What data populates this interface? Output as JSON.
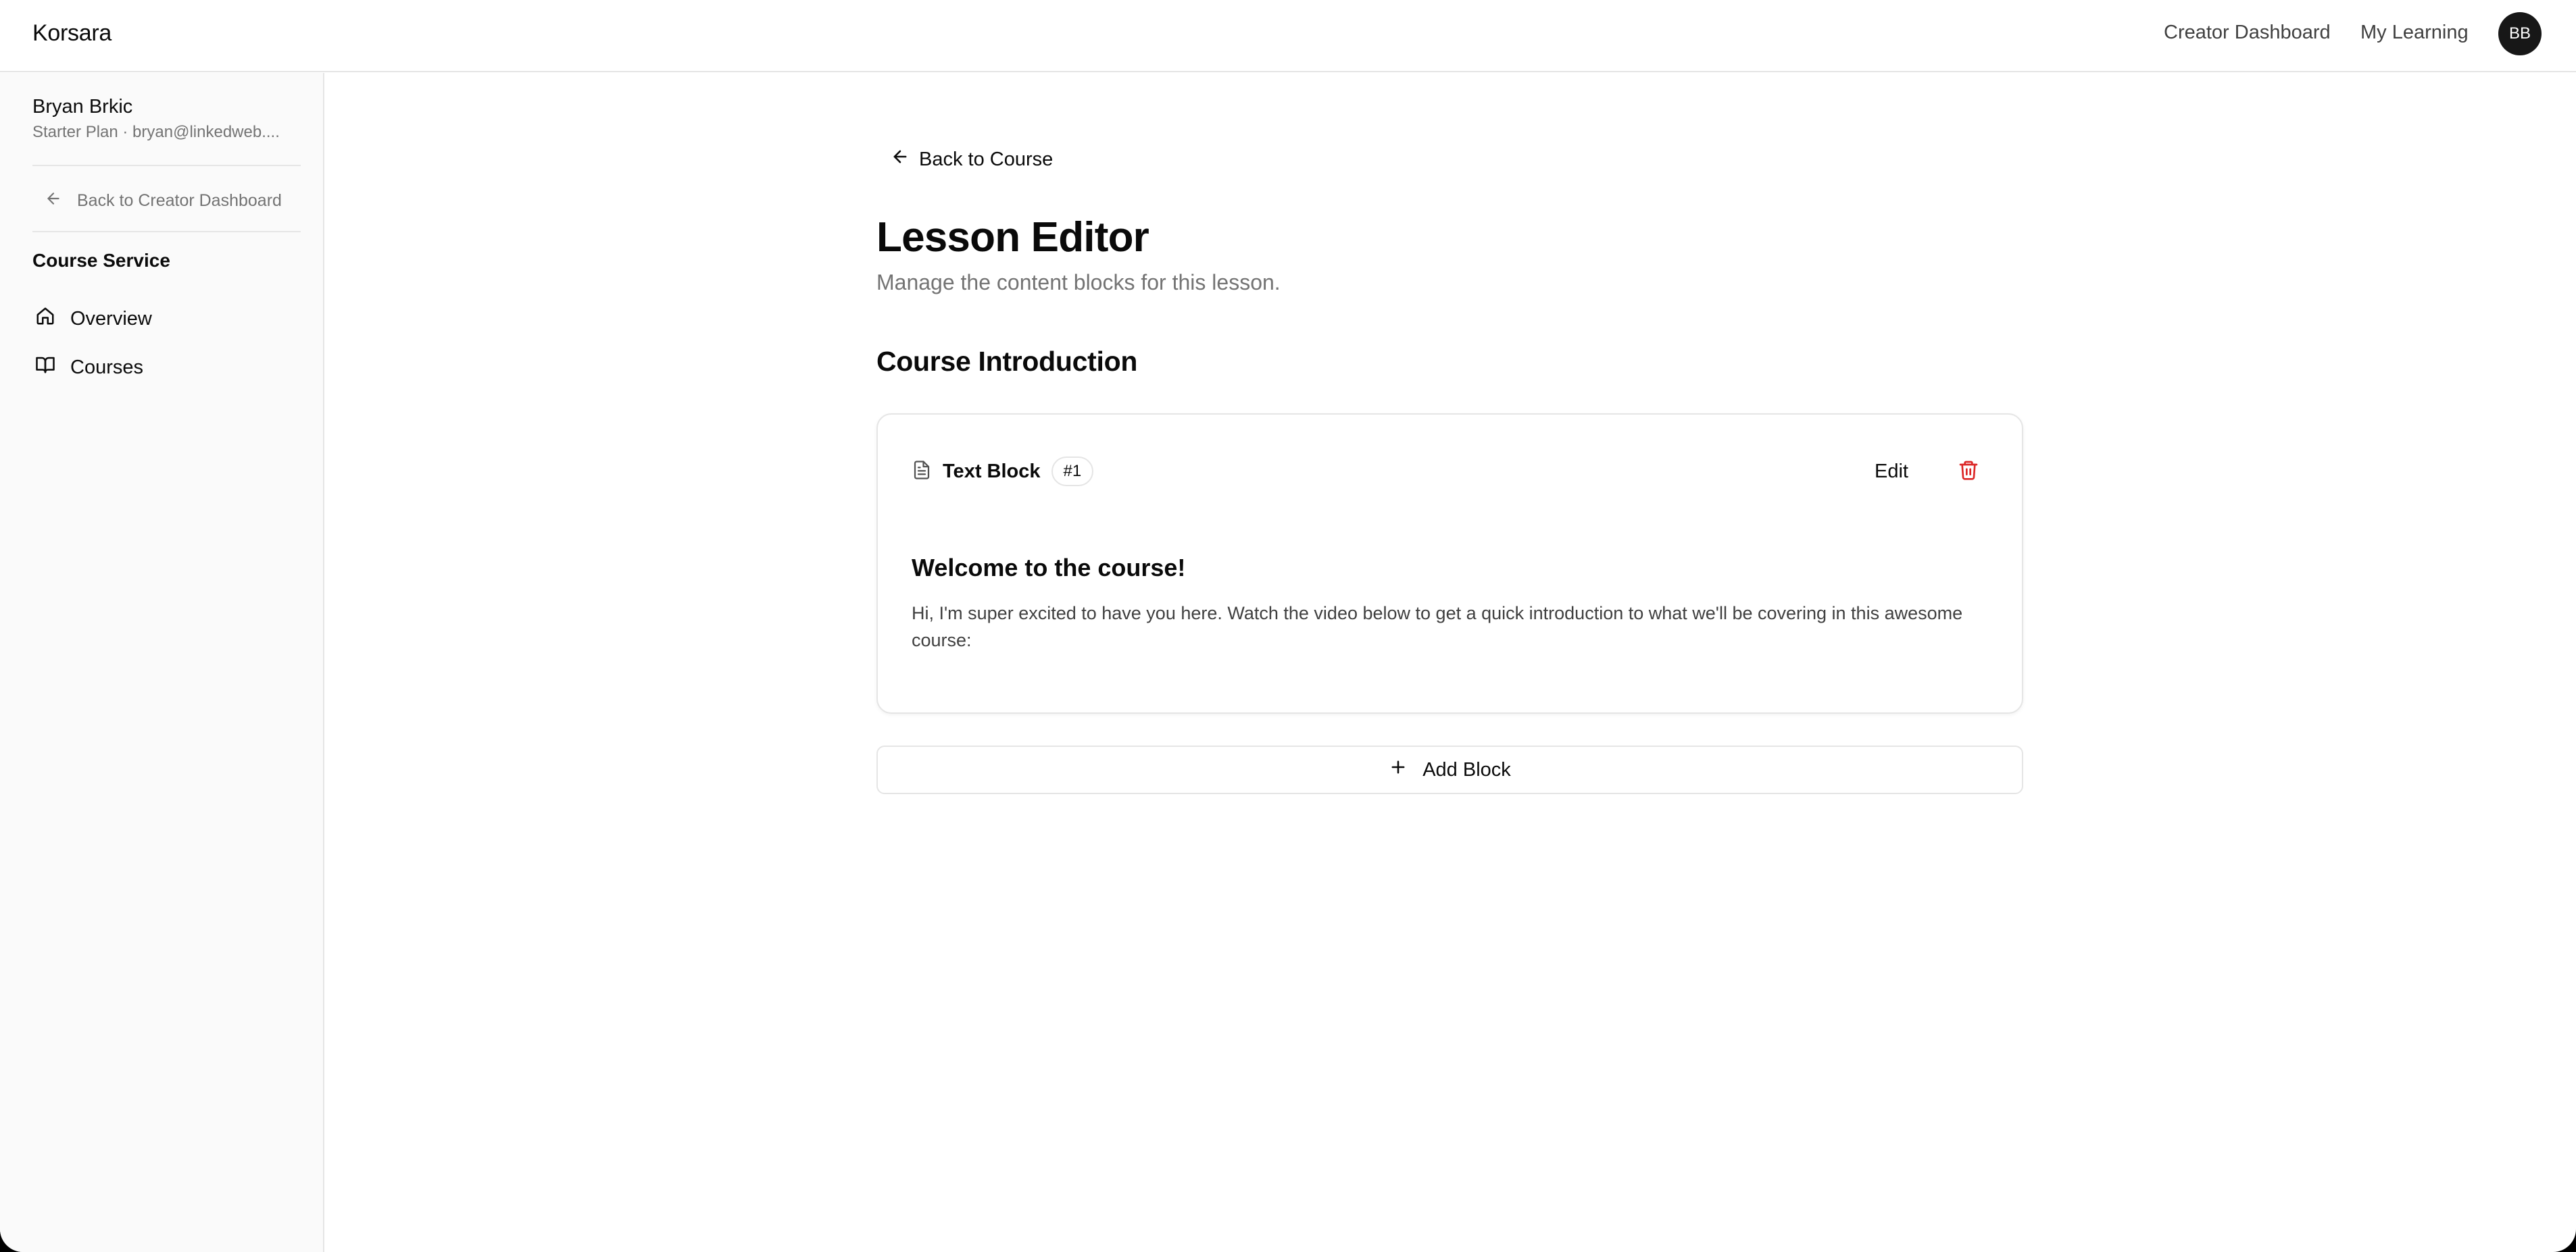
{
  "app": {
    "brand": "Korsara",
    "nav": {
      "creator_dashboard": "Creator Dashboard",
      "my_learning": "My Learning"
    },
    "avatar_initials": "BB"
  },
  "sidebar": {
    "user_name": "Bryan Brkic",
    "user_sub": "Starter Plan · bryan@linkedweb....",
    "back_label": "Back to Creator Dashboard",
    "section_title": "Course Service",
    "items": [
      {
        "label": "Overview",
        "icon": "home-icon"
      },
      {
        "label": "Courses",
        "icon": "book-open-icon"
      }
    ]
  },
  "main": {
    "back_label": "Back to Course",
    "title": "Lesson Editor",
    "subtitle": "Manage the content blocks for this lesson.",
    "lesson_title": "Course Introduction",
    "blocks": [
      {
        "type_label": "Text Block",
        "badge": "#1",
        "icon": "file-text-icon",
        "edit_label": "Edit",
        "heading": "Welcome to the course!",
        "body": "Hi, I'm super excited to have you here. Watch the video below to get a quick introduction to what we'll be covering in this awesome course:"
      }
    ],
    "add_block_label": "Add Block"
  },
  "colors": {
    "delete": "#dc2626",
    "muted_text": "#737373",
    "border": "#e5e5e5",
    "avatar_bg": "#171717"
  }
}
